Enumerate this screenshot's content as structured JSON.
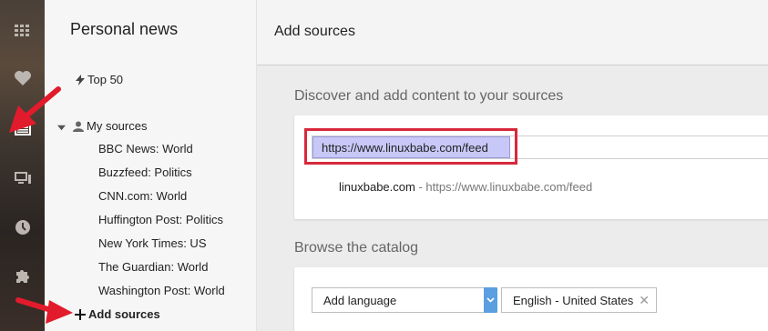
{
  "nav": {
    "title": "Personal news",
    "top50": "Top 50",
    "my_sources": "My sources",
    "sources": [
      "BBC News: World",
      "Buzzfeed: Politics",
      "CNN.com: World",
      "Huffington Post: Politics",
      "New York Times: US",
      "The Guardian: World",
      "Washington Post: World"
    ],
    "add_sources": "Add sources"
  },
  "rail": {
    "icons": [
      "apps-grid-icon",
      "heart-icon",
      "news-icon",
      "monitor-icon",
      "clock-icon",
      "puzzle-icon"
    ],
    "active": "news-icon"
  },
  "main": {
    "title": "Add sources",
    "discover_title": "Discover and add content to your sources",
    "url_value": "https://www.linuxbabe.com/feed",
    "suggestion": {
      "name": "linuxbabe.com",
      "separator": " - ",
      "url": "https://www.linuxbabe.com/feed"
    },
    "catalog_title": "Browse the catalog",
    "language_select": "Add language",
    "language_chip": "English - United States"
  },
  "colors": {
    "highlight": "#d8283c",
    "selection": "#c8c8f8",
    "select_accent": "#5b9fe0"
  }
}
